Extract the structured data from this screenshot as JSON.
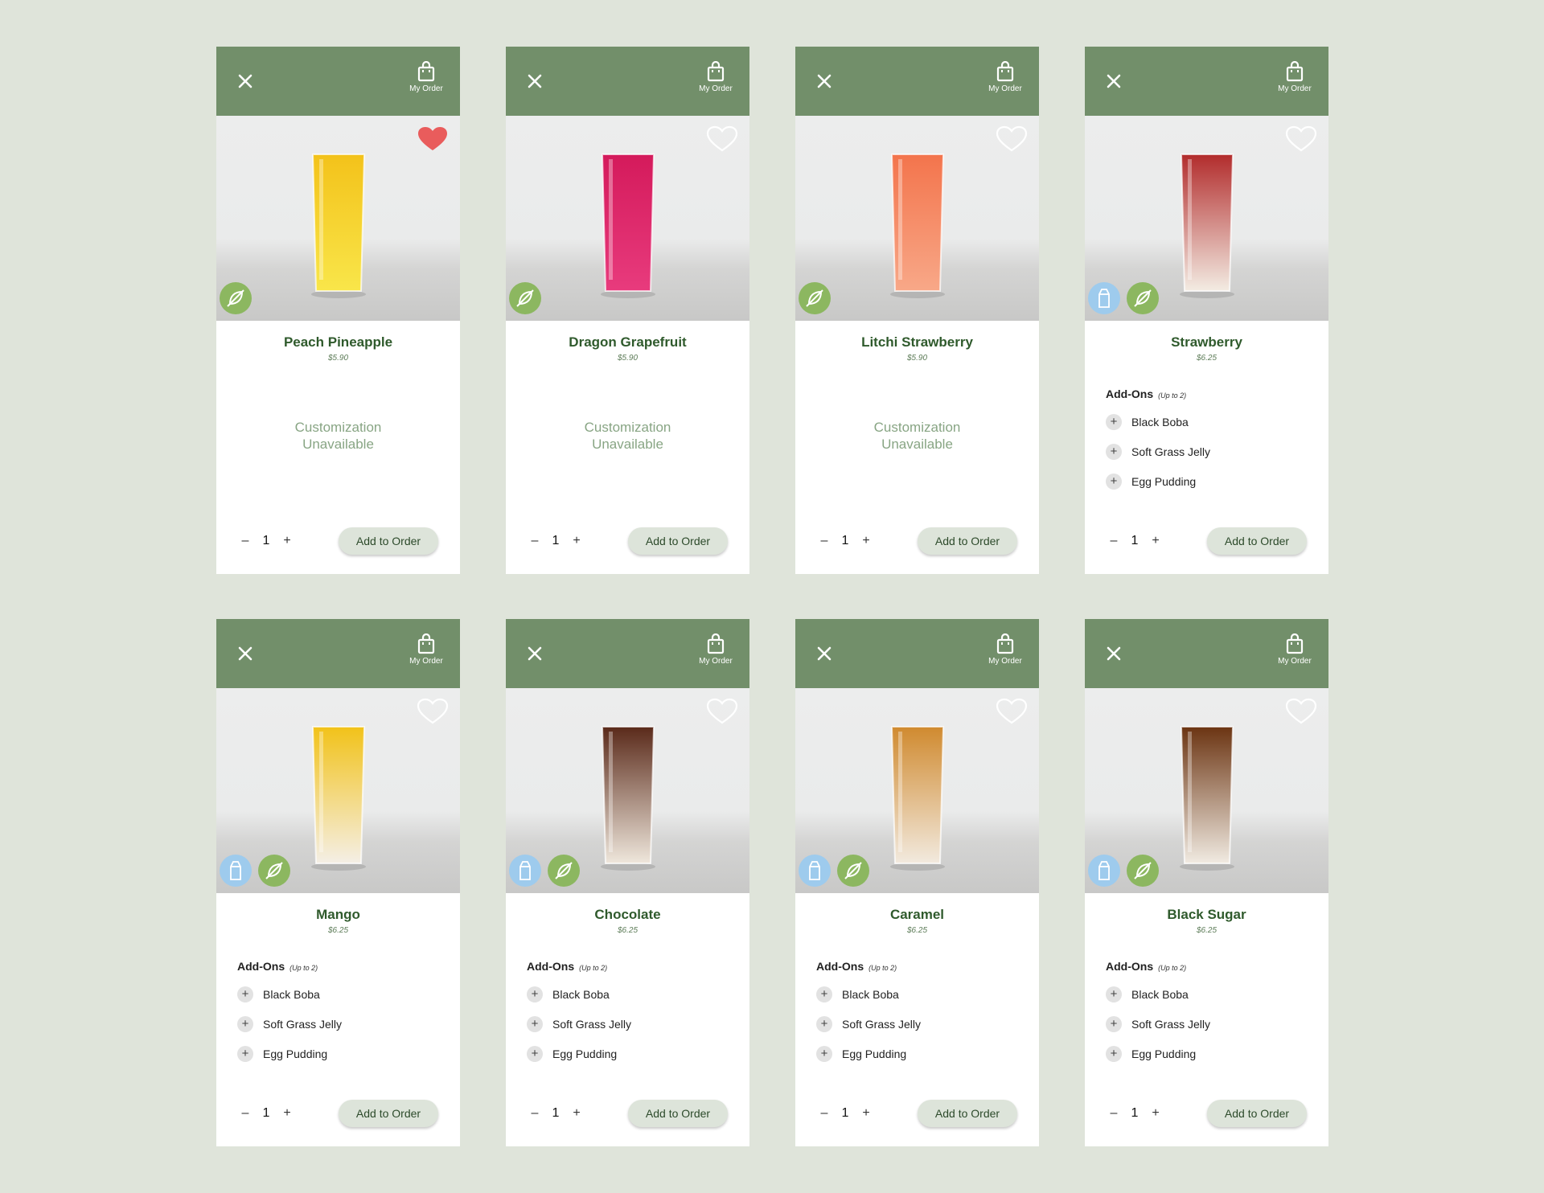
{
  "header": {
    "order_label": "My Order"
  },
  "common": {
    "addons_title": "Add-Ons",
    "addons_note": "(Up to 2)",
    "addon_items": [
      "Black Boba",
      "Soft Grass Jelly",
      "Egg Pudding"
    ],
    "unavailable": "Customization\nUnavailable",
    "add_to_order": "Add to Order",
    "qty_minus": "–",
    "qty_plus": "+"
  },
  "colors": {
    "header_green": "#728f6a",
    "title_green": "#2f5a2c",
    "fav_active": "#e95c5c",
    "badge_vegan": "#8cb760",
    "badge_dairy": "#9ecbed",
    "page_bg": "#dfe4da"
  },
  "cards": [
    {
      "name": "Peach Pineapple",
      "price": "$5.90",
      "favorited": true,
      "customizable": false,
      "dairy": false,
      "qty": "1",
      "drink_colors": [
        "#f3c21a",
        "#f9e64a"
      ]
    },
    {
      "name": "Dragon Grapefruit",
      "price": "$5.90",
      "favorited": false,
      "customizable": false,
      "dairy": false,
      "qty": "1",
      "drink_colors": [
        "#d41a5b",
        "#e83b7d"
      ]
    },
    {
      "name": "Litchi Strawberry",
      "price": "$5.90",
      "favorited": false,
      "customizable": false,
      "dairy": false,
      "qty": "1",
      "drink_colors": [
        "#f3744c",
        "#f8a888"
      ]
    },
    {
      "name": "Strawberry",
      "price": "$6.25",
      "favorited": false,
      "customizable": true,
      "dairy": true,
      "qty": "1",
      "drink_colors": [
        "#b22c2c",
        "#f3ece3"
      ]
    },
    {
      "name": "Mango",
      "price": "$6.25",
      "favorited": false,
      "customizable": true,
      "dairy": true,
      "qty": "1",
      "drink_colors": [
        "#f2c219",
        "#f4efe6"
      ]
    },
    {
      "name": "Chocolate",
      "price": "$6.25",
      "favorited": false,
      "customizable": true,
      "dairy": true,
      "qty": "1",
      "drink_colors": [
        "#5a2a1a",
        "#efe7dc"
      ]
    },
    {
      "name": "Caramel",
      "price": "$6.25",
      "favorited": false,
      "customizable": true,
      "dairy": true,
      "qty": "1",
      "drink_colors": [
        "#d08a2f",
        "#f2eadf"
      ]
    },
    {
      "name": "Black Sugar",
      "price": "$6.25",
      "favorited": false,
      "customizable": true,
      "dairy": true,
      "qty": "1",
      "drink_colors": [
        "#6b3412",
        "#f1ebe2"
      ]
    }
  ]
}
